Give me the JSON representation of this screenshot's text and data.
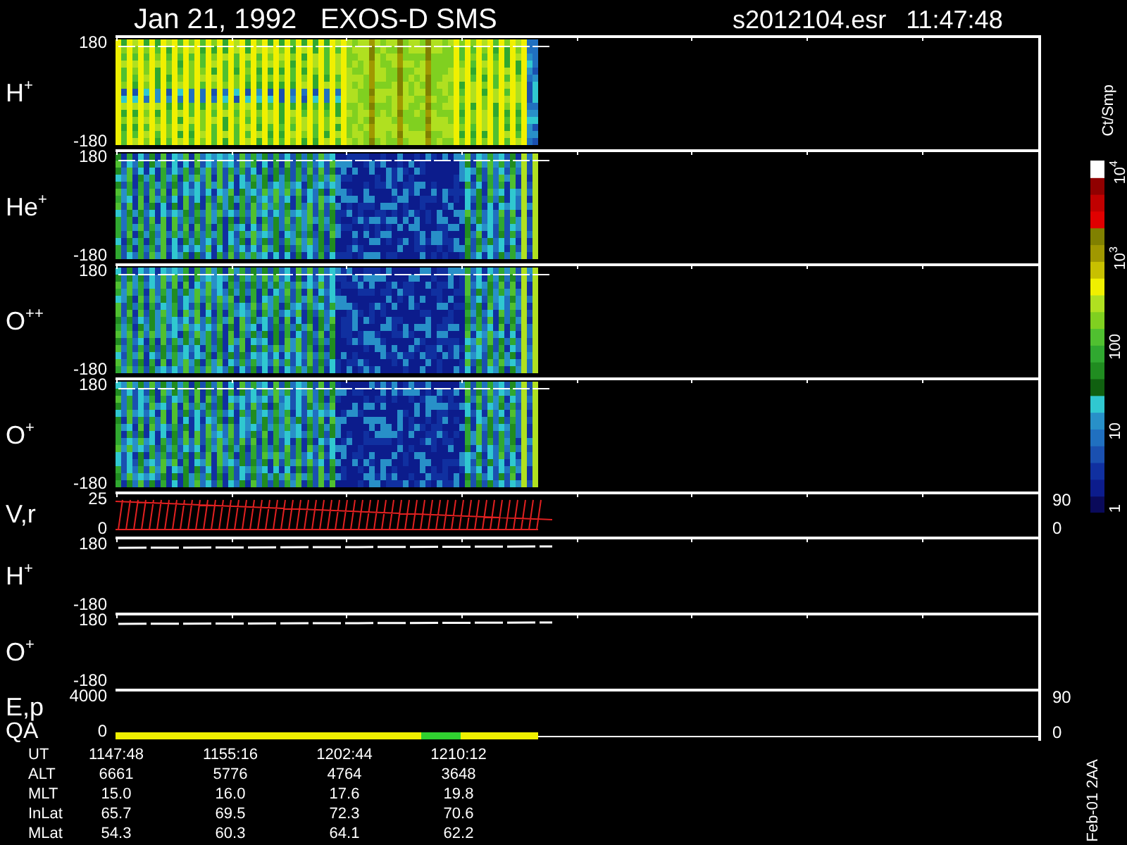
{
  "header": {
    "title": "Jan 21, 1992   EXOS-D SMS",
    "file": "s2012104.esr",
    "time": "11:47:48"
  },
  "panels": [
    {
      "kind": "spectrogram",
      "label": "H$^{+}$",
      "left_ticks": [
        "180",
        "-180"
      ]
    },
    {
      "kind": "spectrogram",
      "label": "He$^{+}$",
      "left_ticks": [
        "180",
        "-180"
      ]
    },
    {
      "kind": "spectrogram",
      "label": "O$^{++}$",
      "left_ticks": [
        "180",
        "-180"
      ]
    },
    {
      "kind": "spectrogram",
      "label": "O$^{+}$",
      "left_ticks": [
        "180",
        "-180"
      ]
    },
    {
      "kind": "velocity",
      "label": "V,r",
      "left_ticks": [
        "25",
        "0"
      ],
      "right_ticks": [
        "90",
        "0"
      ]
    },
    {
      "kind": "line",
      "label": "H$^{+}$",
      "left_ticks": [
        "180",
        "-180"
      ]
    },
    {
      "kind": "line",
      "label": "O$^{+}$",
      "left_ticks": [
        "180",
        "-180"
      ]
    },
    {
      "kind": "energy",
      "label": "E,p",
      "left_ticks": [
        "4000"
      ],
      "right_ticks": [
        "90"
      ]
    },
    {
      "kind": "qa",
      "label": "QA",
      "left_ticks": [
        "0"
      ],
      "right_ticks": [
        "0"
      ]
    }
  ],
  "colorbar": {
    "unit": "Ct/Smp",
    "labels": [
      "10$^{4}$",
      "10$^{3}$",
      "100",
      "10",
      "1"
    ]
  },
  "table": {
    "rows": [
      {
        "label": "UT",
        "values": [
          "1147:48",
          "1155:16",
          "1202:44",
          "1210:12"
        ]
      },
      {
        "label": "ALT",
        "values": [
          "6661",
          "5776",
          "4764",
          "3648"
        ]
      },
      {
        "label": "MLT",
        "values": [
          "15.0",
          "16.0",
          "17.6",
          "19.8"
        ]
      },
      {
        "label": "InLat",
        "values": [
          "65.7",
          "69.5",
          "72.3",
          "70.6"
        ]
      },
      {
        "label": "MLat",
        "values": [
          "54.3",
          "60.3",
          "64.1",
          "62.2"
        ]
      }
    ]
  },
  "footer": "Feb-01 2AA"
}
